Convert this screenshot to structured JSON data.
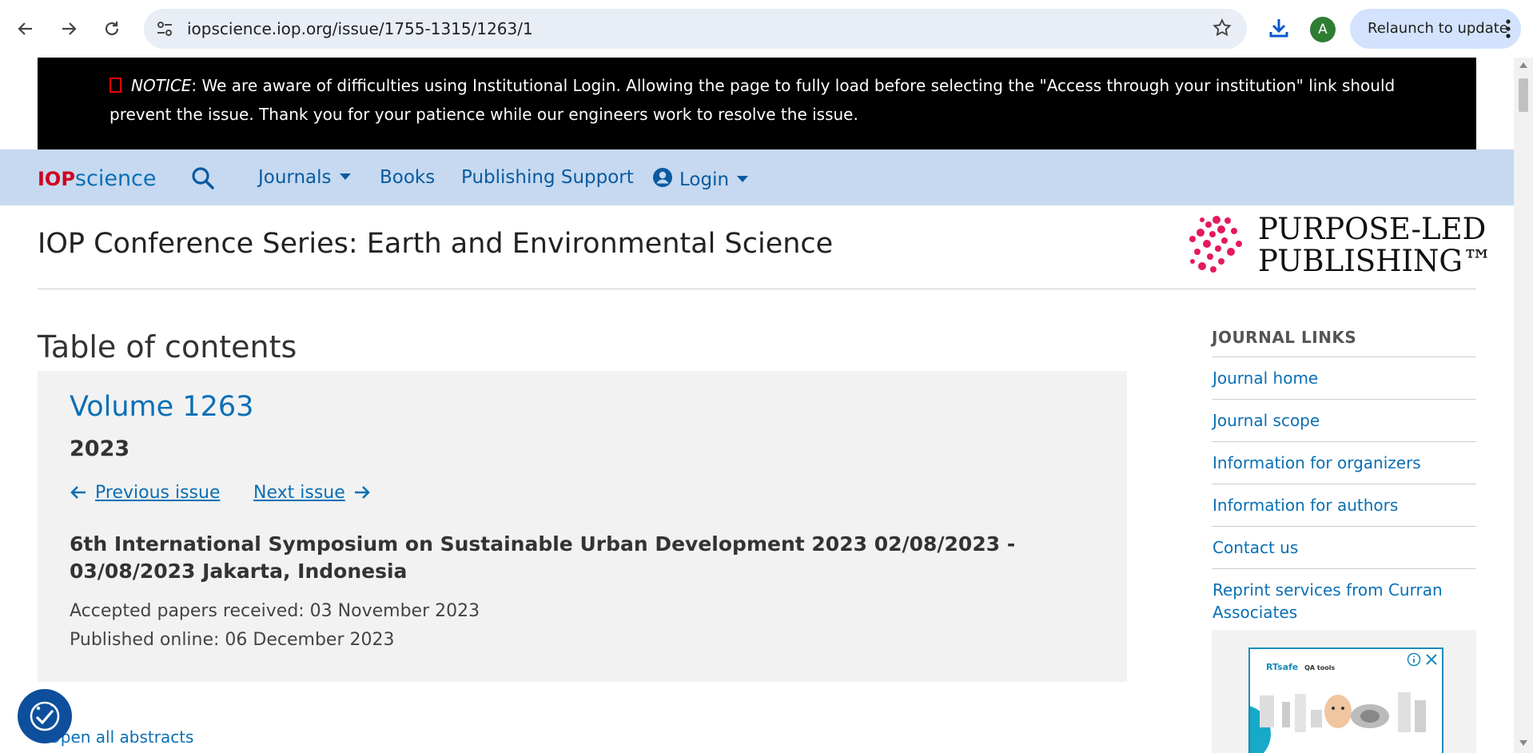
{
  "browser": {
    "url": "iopscience.iop.org/issue/1755-1315/1263/1",
    "avatar_letter": "A",
    "relaunch_label": "Relaunch to update"
  },
  "notice": {
    "label": "NOTICE",
    "text": ": We are aware of difficulties using Institutional Login. Allowing the page to fully load before selecting the \"Access through your institution\" link should prevent the issue. Thank you for your patience while our engineers work to resolve the issue."
  },
  "nav": {
    "logo_iop": "IOP",
    "logo_science": "science",
    "journals": "Journals",
    "books": "Books",
    "publishing_support": "Publishing Support",
    "login": "Login"
  },
  "header": {
    "journal_title": "IOP Conference Series: Earth and Environmental Science",
    "ppl_line1": "PURPOSE-LED",
    "ppl_line2": "PUBLISHING™"
  },
  "toc": {
    "heading": "Table of contents",
    "volume": "Volume 1263",
    "year": "2023",
    "previous_issue": "Previous issue",
    "next_issue": "Next issue",
    "conference": "6th International Symposium on Sustainable Urban Development 2023 02/08/2023 - 03/08/2023 Jakarta, Indonesia",
    "accepted": "Accepted papers received: 03 November 2023",
    "published": "Published online: 06 December 2023",
    "open_all": "Open all abstracts"
  },
  "sidebar": {
    "heading": "JOURNAL LINKS",
    "links": [
      "Journal home",
      "Journal scope",
      "Information for organizers",
      "Information for authors",
      "Contact us",
      "Reprint services from Curran Associates"
    ]
  },
  "ad": {
    "brand": "RTsafe",
    "tagline": "QA tools"
  },
  "colors": {
    "link": "#0a6fb5",
    "nav_bg": "#c6d9f0",
    "notice_bg": "#000000",
    "iop_red": "#d1001f"
  }
}
